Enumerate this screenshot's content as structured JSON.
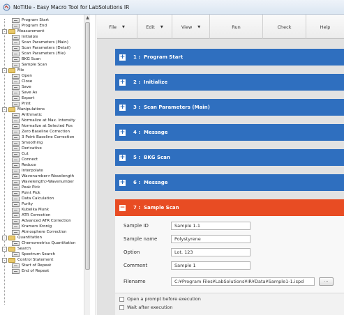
{
  "window": {
    "title": "NoTitle - Easy Macro Tool for LabSolutions IR"
  },
  "toolbar": {
    "file": "File",
    "edit": "Edit",
    "view": "View",
    "run": "Run",
    "check": "Check",
    "help": "Help"
  },
  "tree": [
    {
      "label": "Program Start",
      "type": "item"
    },
    {
      "label": "Program End",
      "type": "item"
    },
    {
      "label": "Measurement",
      "type": "folder"
    },
    {
      "label": "Initialize",
      "type": "item"
    },
    {
      "label": "Scan Parameters (Main)",
      "type": "item"
    },
    {
      "label": "Scan Parameters (Detail)",
      "type": "item"
    },
    {
      "label": "Scan Parameters (File)",
      "type": "item"
    },
    {
      "label": "BKG Scan",
      "type": "item"
    },
    {
      "label": "Sample Scan",
      "type": "item"
    },
    {
      "label": "File",
      "type": "folder"
    },
    {
      "label": "Open",
      "type": "item"
    },
    {
      "label": "Close",
      "type": "item"
    },
    {
      "label": "Save",
      "type": "item"
    },
    {
      "label": "Save As",
      "type": "item"
    },
    {
      "label": "Export",
      "type": "item"
    },
    {
      "label": "Print",
      "type": "item"
    },
    {
      "label": "Manipulations",
      "type": "folder"
    },
    {
      "label": "Arithmetic",
      "type": "item"
    },
    {
      "label": "Normalize at Max. Intensity",
      "type": "item"
    },
    {
      "label": "Normalize at Selected Pos",
      "type": "item"
    },
    {
      "label": "Zero Baseline Correction",
      "type": "item"
    },
    {
      "label": "3 Point Baseline Correction",
      "type": "item"
    },
    {
      "label": "Smoothing",
      "type": "item"
    },
    {
      "label": "Derivative",
      "type": "item"
    },
    {
      "label": "Cut",
      "type": "item"
    },
    {
      "label": "Connect",
      "type": "item"
    },
    {
      "label": "Reduce",
      "type": "item"
    },
    {
      "label": "Interpolate",
      "type": "item"
    },
    {
      "label": "Wavenumber>Wavelength",
      "type": "item"
    },
    {
      "label": "Wavelength>Wavenumber",
      "type": "item"
    },
    {
      "label": "Peak Pick",
      "type": "item"
    },
    {
      "label": "Point Pick",
      "type": "item"
    },
    {
      "label": "Data Calculation",
      "type": "item"
    },
    {
      "label": "Purity",
      "type": "item"
    },
    {
      "label": "Kubelka Munk",
      "type": "item"
    },
    {
      "label": "ATR Correction",
      "type": "item"
    },
    {
      "label": "Advanced ATR Correction",
      "type": "item"
    },
    {
      "label": "Kramers Kronig",
      "type": "item"
    },
    {
      "label": "Atmosphere Correction",
      "type": "item"
    },
    {
      "label": "Quantitation",
      "type": "folder"
    },
    {
      "label": "Chemometrics Quantitation",
      "type": "item"
    },
    {
      "label": "Search",
      "type": "folder"
    },
    {
      "label": "Spectrum Search",
      "type": "item"
    },
    {
      "label": "Control Statement",
      "type": "folder"
    },
    {
      "label": "Start of Repeat",
      "type": "item"
    },
    {
      "label": "End of Repeat",
      "type": "item"
    }
  ],
  "steps": [
    {
      "num": "1",
      "label": "Program Start"
    },
    {
      "num": "2",
      "label": "Initialize"
    },
    {
      "num": "3",
      "label": "Scan Parameters (Main)"
    },
    {
      "num": "4",
      "label": "Message"
    },
    {
      "num": "5",
      "label": "BKG Scan"
    },
    {
      "num": "6",
      "label": "Message"
    },
    {
      "num": "7",
      "label": "Sample Scan"
    }
  ],
  "step_separator": ":",
  "toggles": {
    "collapsed": "+",
    "expanded": "−"
  },
  "sample_scan": {
    "sample_id_label": "Sample ID",
    "sample_id": "Sample 1-1",
    "sample_name_label": "Sample name",
    "sample_name": "Polystyrene",
    "option_label": "Option",
    "option": "Lot. 123",
    "comment_label": "Comment",
    "comment": "Sample 1",
    "filename_label": "Filename",
    "filename": "C:¥Program Files¥LabSolutions¥IR¥Data¥Sample1-1.ispd",
    "browse_label": "...",
    "prompt_label": "Open a prompt before execution",
    "wait_label": "Wait after execution"
  },
  "colors": {
    "step_bar": "#2f6fbf",
    "active_step_bar": "#e84c23",
    "content_background": "#e2e2e2"
  }
}
